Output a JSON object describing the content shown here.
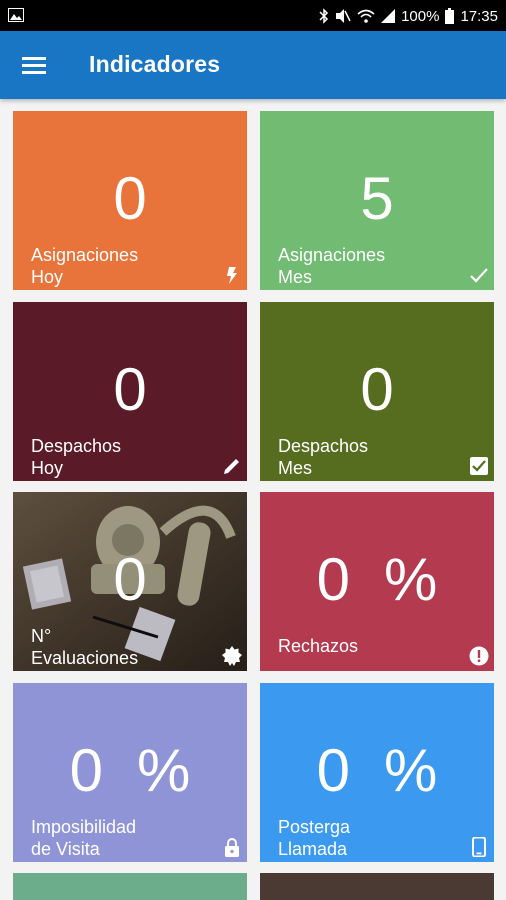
{
  "status_bar": {
    "battery": "100%",
    "time": "17:35",
    "icons": [
      "image-icon",
      "bluetooth-icon",
      "mute-icon",
      "wifi-icon",
      "signal-icon",
      "battery-icon"
    ]
  },
  "app_bar": {
    "title": "Indicadores",
    "menu_icon": "menu-icon"
  },
  "tiles": [
    {
      "value": "0",
      "line1": "Asignaciones",
      "line2": "Hoy",
      "icon": "flash-icon",
      "color": "#e8743b"
    },
    {
      "value": "5",
      "line1": "Asignaciones",
      "line2": "Mes",
      "icon": "check-icon",
      "color": "#72bb72"
    },
    {
      "value": "0",
      "line1": "Despachos",
      "line2": "Hoy",
      "icon": "pencil-icon",
      "color": "#5a1a27"
    },
    {
      "value": "0",
      "line1": "Despachos",
      "line2": "Mes",
      "icon": "checkbox-icon",
      "color": "#566d1f"
    },
    {
      "value": "0",
      "line1": "N°",
      "line2": "Evaluaciones",
      "icon": "badge-icon",
      "color": "#4a3d30"
    },
    {
      "value": "0",
      "unit": "%",
      "line1": "Rechazos",
      "icon": "alert-circle-icon",
      "color": "#b43a4f"
    },
    {
      "value": "0",
      "unit": "%",
      "line1": "Imposibilidad",
      "line2": "de Visita",
      "icon": "lock-icon",
      "color": "#8f94d6"
    },
    {
      "value": "0",
      "unit": "%",
      "line1": "Posterga",
      "line2": "Llamada",
      "icon": "phone-icon",
      "color": "#3b9af0"
    },
    {
      "color": "#6cae8b"
    },
    {
      "color": "#4a3a33"
    }
  ]
}
